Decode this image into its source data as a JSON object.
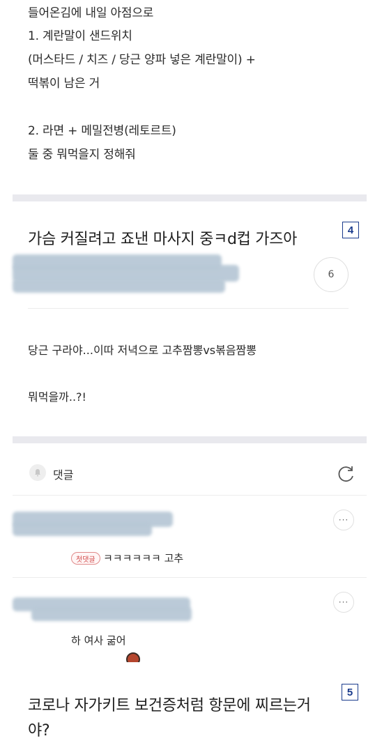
{
  "post_top": {
    "lines": [
      "들어온김에 내일 아점으로",
      "1. 계란말이 샌드위치",
      "(머스타드 / 치즈 / 당근 양파 넣은 계란말이) +",
      "떡볶이 남은 거",
      "2. 라면 + 메밀전병(레토르트)",
      "둘 중 뭐먹을지 정해줘"
    ]
  },
  "post_4": {
    "title": "가슴 커질려고 죠낸 마사지 중ㅋd컵 가즈아",
    "badge": "4",
    "comment_count": "6",
    "body_lines": [
      "당근 구라야...이따 저녁으로 고추짬뽕vs볶음짬뽕",
      "뭐먹을까..?!"
    ]
  },
  "comments": {
    "header_label": "댓글",
    "items": [
      {
        "first_badge": "첫댓글",
        "text": "ㅋㅋㅋㅋㅋㅋ 고추",
        "more": "···"
      },
      {
        "text": "하 여사 굶어",
        "more": "···"
      }
    ]
  },
  "post_5": {
    "title_line1": "코로나 자가키트 보건증처럼 항문에 찌르는거",
    "title_line2": "야?",
    "badge": "5"
  },
  "colors": {
    "badge_blue": "#1a3b8c",
    "divider": "#e9e9ee",
    "blur": "#b8c8d6",
    "first_badge_red": "#d24b4b"
  }
}
